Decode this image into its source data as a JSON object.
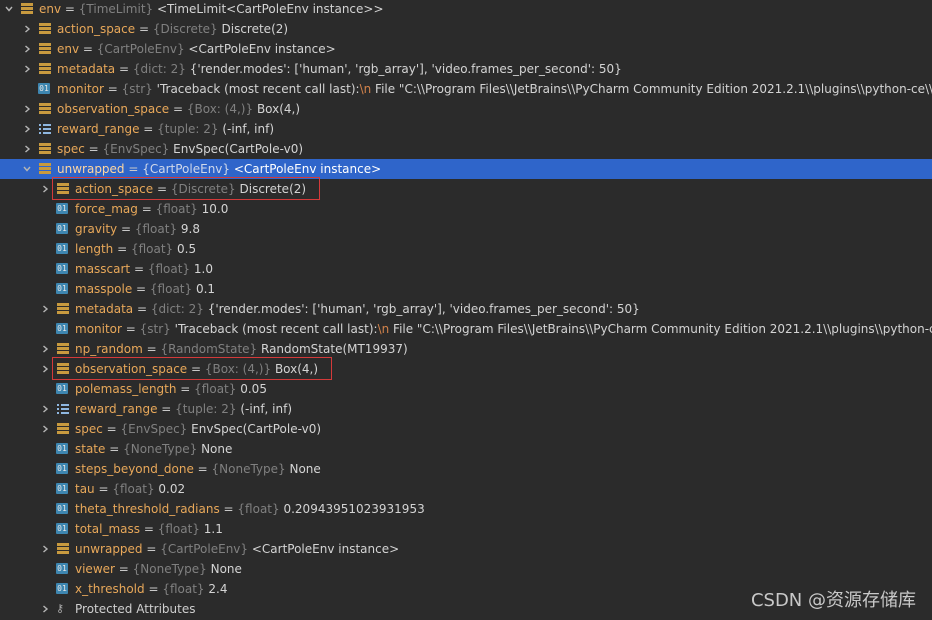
{
  "rows": [
    {
      "indent": 0,
      "arrow": "down",
      "icon": "obj",
      "name": "env",
      "type": "{TimeLimit}",
      "value": "<TimeLimit<CartPoleEnv instance>>"
    },
    {
      "indent": 1,
      "arrow": "right",
      "icon": "obj",
      "name": "action_space",
      "type": "{Discrete}",
      "value": "Discrete(2)"
    },
    {
      "indent": 1,
      "arrow": "right",
      "icon": "obj",
      "name": "env",
      "type": "{CartPoleEnv}",
      "value": "<CartPoleEnv instance>"
    },
    {
      "indent": 1,
      "arrow": "right",
      "icon": "obj",
      "name": "metadata",
      "type": "{dict: 2}",
      "value": "{'render.modes': ['human', 'rgb_array'], 'video.frames_per_second': 50}"
    },
    {
      "indent": 1,
      "arrow": "none",
      "icon": "num",
      "name": "monitor",
      "type": "{str}",
      "value": "'Traceback (most recent call last):",
      "esc": "\\n",
      "value2": "  File \"C:\\\\Program Files\\\\JetBrains\\\\PyCharm Community Edition 2021.2.1\\\\plugins\\\\python-ce\\\\helpe"
    },
    {
      "indent": 1,
      "arrow": "right",
      "icon": "obj",
      "name": "observation_space",
      "type": "{Box: (4,)}",
      "value": "Box(4,)"
    },
    {
      "indent": 1,
      "arrow": "right",
      "icon": "list",
      "name": "reward_range",
      "type": "{tuple: 2}",
      "value": "(-inf, inf)"
    },
    {
      "indent": 1,
      "arrow": "right",
      "icon": "obj",
      "name": "spec",
      "type": "{EnvSpec}",
      "value": "EnvSpec(CartPole-v0)"
    },
    {
      "indent": 1,
      "arrow": "down",
      "icon": "obj",
      "name": "unwrapped",
      "type": "{CartPoleEnv}",
      "value": "<CartPoleEnv instance>",
      "selected": true
    },
    {
      "indent": 2,
      "arrow": "right",
      "icon": "obj",
      "name": "action_space",
      "type": "{Discrete}",
      "value": "Discrete(2)",
      "boxed": true
    },
    {
      "indent": 2,
      "arrow": "none",
      "icon": "num",
      "name": "force_mag",
      "type": "{float}",
      "value": "10.0"
    },
    {
      "indent": 2,
      "arrow": "none",
      "icon": "num",
      "name": "gravity",
      "type": "{float}",
      "value": "9.8"
    },
    {
      "indent": 2,
      "arrow": "none",
      "icon": "num",
      "name": "length",
      "type": "{float}",
      "value": "0.5"
    },
    {
      "indent": 2,
      "arrow": "none",
      "icon": "num",
      "name": "masscart",
      "type": "{float}",
      "value": "1.0"
    },
    {
      "indent": 2,
      "arrow": "none",
      "icon": "num",
      "name": "masspole",
      "type": "{float}",
      "value": "0.1"
    },
    {
      "indent": 2,
      "arrow": "right",
      "icon": "obj",
      "name": "metadata",
      "type": "{dict: 2}",
      "value": "{'render.modes': ['human', 'rgb_array'], 'video.frames_per_second': 50}"
    },
    {
      "indent": 2,
      "arrow": "none",
      "icon": "num",
      "name": "monitor",
      "type": "{str}",
      "value": "'Traceback (most recent call last):",
      "esc": "\\n",
      "value2": "  File \"C:\\\\Program Files\\\\JetBrains\\\\PyCharm Community Edition 2021.2.1\\\\plugins\\\\python-ce\\\\he"
    },
    {
      "indent": 2,
      "arrow": "right",
      "icon": "obj",
      "name": "np_random",
      "type": "{RandomState}",
      "value": "RandomState(MT19937)"
    },
    {
      "indent": 2,
      "arrow": "right",
      "icon": "obj",
      "name": "observation_space",
      "type": "{Box: (4,)}",
      "value": "Box(4,)",
      "boxed": true
    },
    {
      "indent": 2,
      "arrow": "none",
      "icon": "num",
      "name": "polemass_length",
      "type": "{float}",
      "value": "0.05"
    },
    {
      "indent": 2,
      "arrow": "right",
      "icon": "list",
      "name": "reward_range",
      "type": "{tuple: 2}",
      "value": "(-inf, inf)"
    },
    {
      "indent": 2,
      "arrow": "right",
      "icon": "obj",
      "name": "spec",
      "type": "{EnvSpec}",
      "value": "EnvSpec(CartPole-v0)"
    },
    {
      "indent": 2,
      "arrow": "none",
      "icon": "num",
      "name": "state",
      "type": "{NoneType}",
      "value": "None"
    },
    {
      "indent": 2,
      "arrow": "none",
      "icon": "num",
      "name": "steps_beyond_done",
      "type": "{NoneType}",
      "value": "None"
    },
    {
      "indent": 2,
      "arrow": "none",
      "icon": "num",
      "name": "tau",
      "type": "{float}",
      "value": "0.02"
    },
    {
      "indent": 2,
      "arrow": "none",
      "icon": "num",
      "name": "theta_threshold_radians",
      "type": "{float}",
      "value": "0.20943951023931953"
    },
    {
      "indent": 2,
      "arrow": "none",
      "icon": "num",
      "name": "total_mass",
      "type": "{float}",
      "value": "1.1"
    },
    {
      "indent": 2,
      "arrow": "right",
      "icon": "obj",
      "name": "unwrapped",
      "type": "{CartPoleEnv}",
      "value": "<CartPoleEnv instance>"
    },
    {
      "indent": 2,
      "arrow": "none",
      "icon": "num",
      "name": "viewer",
      "type": "{NoneType}",
      "value": "None"
    },
    {
      "indent": 2,
      "arrow": "none",
      "icon": "num",
      "name": "x_threshold",
      "type": "{float}",
      "value": "2.4"
    },
    {
      "indent": 2,
      "arrow": "right",
      "icon": "prot",
      "plain": "Protected Attributes"
    }
  ],
  "icon_names": {
    "obj": "object-icon",
    "num": "number-icon",
    "list": "list-icon",
    "prot": "protected-attributes-icon"
  },
  "icon_num_label": "01",
  "watermark": "CSDN @资源存储库",
  "colors": {
    "background": "#2b2b2b",
    "selection": "#2f65ca",
    "name": "#e8a85a",
    "type": "#808080",
    "highlight_box": "#d43a3a"
  }
}
